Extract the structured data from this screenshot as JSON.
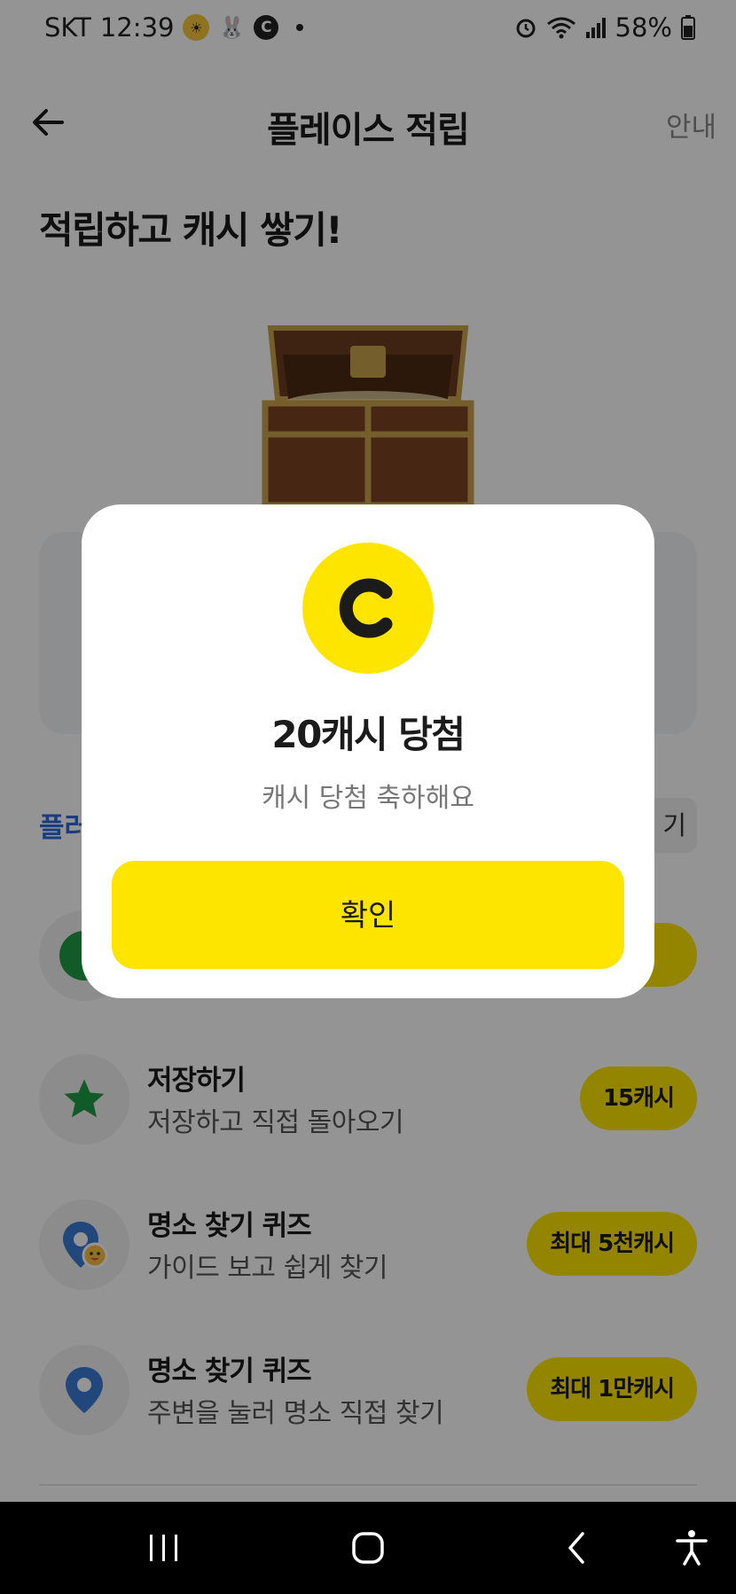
{
  "status_bar": {
    "carrier": "SKT",
    "time": "12:39",
    "battery": "58%",
    "icons": [
      "sun-icon",
      "rabbit-icon",
      "c-badge-icon",
      "alarm-icon",
      "wifi-icon",
      "signal-icon",
      "battery-icon"
    ]
  },
  "header": {
    "title": "플레이스 적립",
    "guide_label": "안내",
    "back_icon": "arrow-left-icon"
  },
  "headline": "적립하고 캐시 쌓기!",
  "section": {
    "label_visible": "플러",
    "right_label_visible": "기"
  },
  "list_items": [
    {
      "icon": "star-icon",
      "title": "저장하기",
      "subtitle": "저장하고 직접 돌아오기",
      "reward": "15캐시"
    },
    {
      "icon": "location-pin-emoji-icon",
      "title": "명소 찾기 퀴즈",
      "subtitle": "가이드 보고 쉽게 찾기",
      "reward": "최대 5천캐시"
    },
    {
      "icon": "location-pin-icon",
      "title": "명소 찾기 퀴즈",
      "subtitle": "주변을 눌러 명소 직접 찾기",
      "reward": "최대 1만캐시"
    }
  ],
  "modal": {
    "coin_letter": "C",
    "title": "20캐시 당첨",
    "subtitle": "캐시 당첨 축하해요",
    "confirm_label": "확인"
  },
  "colors": {
    "accent_yellow": "#fee500",
    "section_blue": "#2b69d9",
    "star_green": "#1e9e46",
    "pin_blue": "#3b7bd6"
  }
}
